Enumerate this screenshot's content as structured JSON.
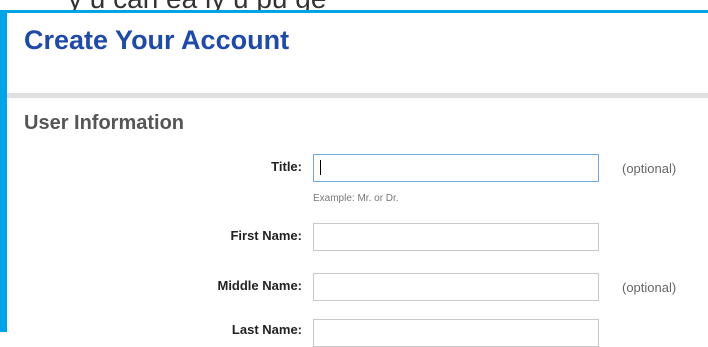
{
  "header_text": "y u can ea ly u pu ge",
  "page_title": "Create Your Account",
  "section_title": "User Information",
  "fields": [
    {
      "label": "Title:",
      "value": "",
      "optional": "(optional)",
      "hint": "Example: Mr. or Dr."
    },
    {
      "label": "First Name:",
      "value": ""
    },
    {
      "label": "Middle Name:",
      "value": "",
      "optional": "(optional)"
    },
    {
      "label": "Last Name:",
      "value": ""
    }
  ],
  "colors": {
    "accent": "#00a2e8",
    "title": "#1f4aa6"
  }
}
